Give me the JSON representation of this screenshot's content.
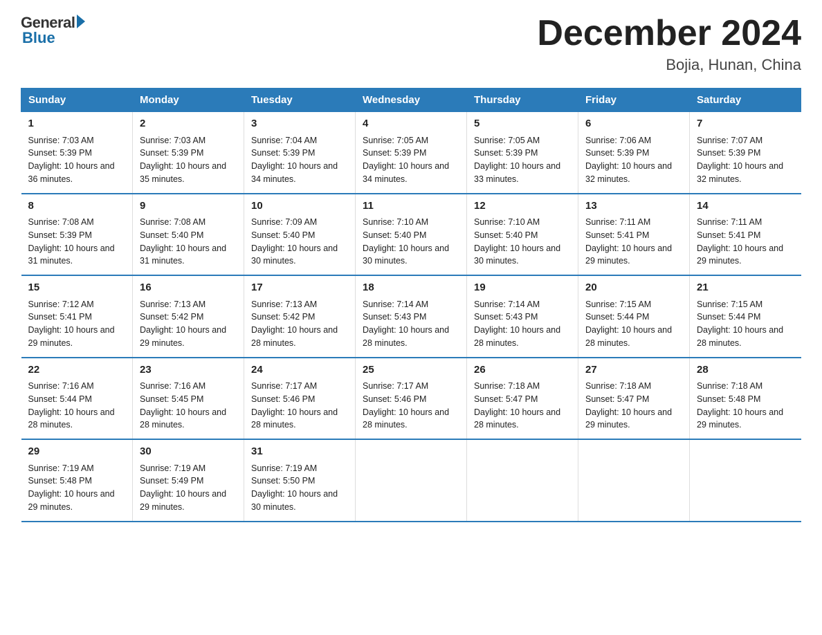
{
  "logo": {
    "general": "General",
    "blue": "Blue"
  },
  "title": "December 2024",
  "subtitle": "Bojia, Hunan, China",
  "headers": [
    "Sunday",
    "Monday",
    "Tuesday",
    "Wednesday",
    "Thursday",
    "Friday",
    "Saturday"
  ],
  "weeks": [
    [
      {
        "day": "1",
        "sunrise": "7:03 AM",
        "sunset": "5:39 PM",
        "daylight": "10 hours and 36 minutes."
      },
      {
        "day": "2",
        "sunrise": "7:03 AM",
        "sunset": "5:39 PM",
        "daylight": "10 hours and 35 minutes."
      },
      {
        "day": "3",
        "sunrise": "7:04 AM",
        "sunset": "5:39 PM",
        "daylight": "10 hours and 34 minutes."
      },
      {
        "day": "4",
        "sunrise": "7:05 AM",
        "sunset": "5:39 PM",
        "daylight": "10 hours and 34 minutes."
      },
      {
        "day": "5",
        "sunrise": "7:05 AM",
        "sunset": "5:39 PM",
        "daylight": "10 hours and 33 minutes."
      },
      {
        "day": "6",
        "sunrise": "7:06 AM",
        "sunset": "5:39 PM",
        "daylight": "10 hours and 32 minutes."
      },
      {
        "day": "7",
        "sunrise": "7:07 AM",
        "sunset": "5:39 PM",
        "daylight": "10 hours and 32 minutes."
      }
    ],
    [
      {
        "day": "8",
        "sunrise": "7:08 AM",
        "sunset": "5:39 PM",
        "daylight": "10 hours and 31 minutes."
      },
      {
        "day": "9",
        "sunrise": "7:08 AM",
        "sunset": "5:40 PM",
        "daylight": "10 hours and 31 minutes."
      },
      {
        "day": "10",
        "sunrise": "7:09 AM",
        "sunset": "5:40 PM",
        "daylight": "10 hours and 30 minutes."
      },
      {
        "day": "11",
        "sunrise": "7:10 AM",
        "sunset": "5:40 PM",
        "daylight": "10 hours and 30 minutes."
      },
      {
        "day": "12",
        "sunrise": "7:10 AM",
        "sunset": "5:40 PM",
        "daylight": "10 hours and 30 minutes."
      },
      {
        "day": "13",
        "sunrise": "7:11 AM",
        "sunset": "5:41 PM",
        "daylight": "10 hours and 29 minutes."
      },
      {
        "day": "14",
        "sunrise": "7:11 AM",
        "sunset": "5:41 PM",
        "daylight": "10 hours and 29 minutes."
      }
    ],
    [
      {
        "day": "15",
        "sunrise": "7:12 AM",
        "sunset": "5:41 PM",
        "daylight": "10 hours and 29 minutes."
      },
      {
        "day": "16",
        "sunrise": "7:13 AM",
        "sunset": "5:42 PM",
        "daylight": "10 hours and 29 minutes."
      },
      {
        "day": "17",
        "sunrise": "7:13 AM",
        "sunset": "5:42 PM",
        "daylight": "10 hours and 28 minutes."
      },
      {
        "day": "18",
        "sunrise": "7:14 AM",
        "sunset": "5:43 PM",
        "daylight": "10 hours and 28 minutes."
      },
      {
        "day": "19",
        "sunrise": "7:14 AM",
        "sunset": "5:43 PM",
        "daylight": "10 hours and 28 minutes."
      },
      {
        "day": "20",
        "sunrise": "7:15 AM",
        "sunset": "5:44 PM",
        "daylight": "10 hours and 28 minutes."
      },
      {
        "day": "21",
        "sunrise": "7:15 AM",
        "sunset": "5:44 PM",
        "daylight": "10 hours and 28 minutes."
      }
    ],
    [
      {
        "day": "22",
        "sunrise": "7:16 AM",
        "sunset": "5:44 PM",
        "daylight": "10 hours and 28 minutes."
      },
      {
        "day": "23",
        "sunrise": "7:16 AM",
        "sunset": "5:45 PM",
        "daylight": "10 hours and 28 minutes."
      },
      {
        "day": "24",
        "sunrise": "7:17 AM",
        "sunset": "5:46 PM",
        "daylight": "10 hours and 28 minutes."
      },
      {
        "day": "25",
        "sunrise": "7:17 AM",
        "sunset": "5:46 PM",
        "daylight": "10 hours and 28 minutes."
      },
      {
        "day": "26",
        "sunrise": "7:18 AM",
        "sunset": "5:47 PM",
        "daylight": "10 hours and 28 minutes."
      },
      {
        "day": "27",
        "sunrise": "7:18 AM",
        "sunset": "5:47 PM",
        "daylight": "10 hours and 29 minutes."
      },
      {
        "day": "28",
        "sunrise": "7:18 AM",
        "sunset": "5:48 PM",
        "daylight": "10 hours and 29 minutes."
      }
    ],
    [
      {
        "day": "29",
        "sunrise": "7:19 AM",
        "sunset": "5:48 PM",
        "daylight": "10 hours and 29 minutes."
      },
      {
        "day": "30",
        "sunrise": "7:19 AM",
        "sunset": "5:49 PM",
        "daylight": "10 hours and 29 minutes."
      },
      {
        "day": "31",
        "sunrise": "7:19 AM",
        "sunset": "5:50 PM",
        "daylight": "10 hours and 30 minutes."
      },
      {
        "day": "",
        "sunrise": "",
        "sunset": "",
        "daylight": ""
      },
      {
        "day": "",
        "sunrise": "",
        "sunset": "",
        "daylight": ""
      },
      {
        "day": "",
        "sunrise": "",
        "sunset": "",
        "daylight": ""
      },
      {
        "day": "",
        "sunrise": "",
        "sunset": "",
        "daylight": ""
      }
    ]
  ]
}
